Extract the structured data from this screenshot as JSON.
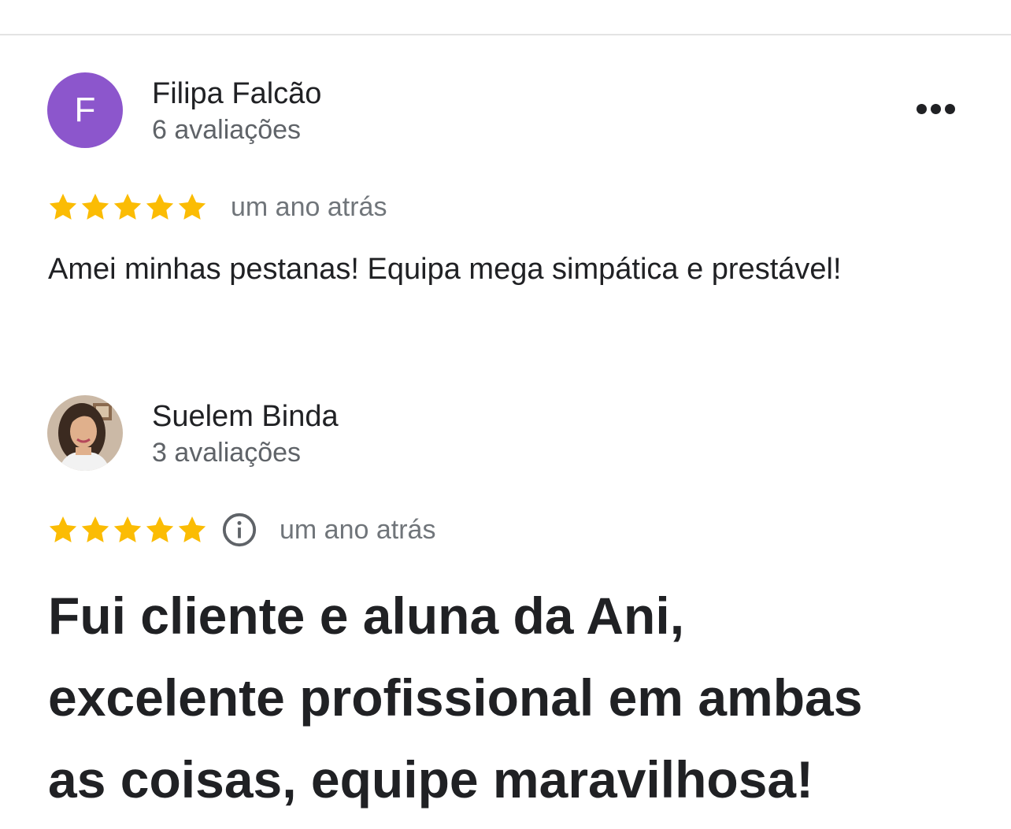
{
  "reviews": [
    {
      "author_name": "Filipa Falcão",
      "avatar_letter": "F",
      "avatar_color": "#8c56cc",
      "review_count": "6 avaliações",
      "rating": 5,
      "date": "um ano atrás",
      "text": "Amei minhas pestanas! Equipa mega simpática e prestável!",
      "has_more_menu": true
    },
    {
      "author_name": "Suelem Binda",
      "avatar_type": "photo",
      "review_count": "3 avaliações",
      "rating": 5,
      "has_info_icon": true,
      "date": "um ano atrás",
      "text": "Fui cliente e aluna da Ani,\nexcelente profissional em ambas\nas coisas, equipe maravilhosa!"
    }
  ],
  "colors": {
    "star": "#fbbc04",
    "primary_text": "#202124",
    "secondary_text": "#5f6368",
    "divider": "#e3e3e3"
  },
  "icons": {
    "star": "star-icon",
    "more": "more-horizontal-icon",
    "info": "info-icon"
  }
}
